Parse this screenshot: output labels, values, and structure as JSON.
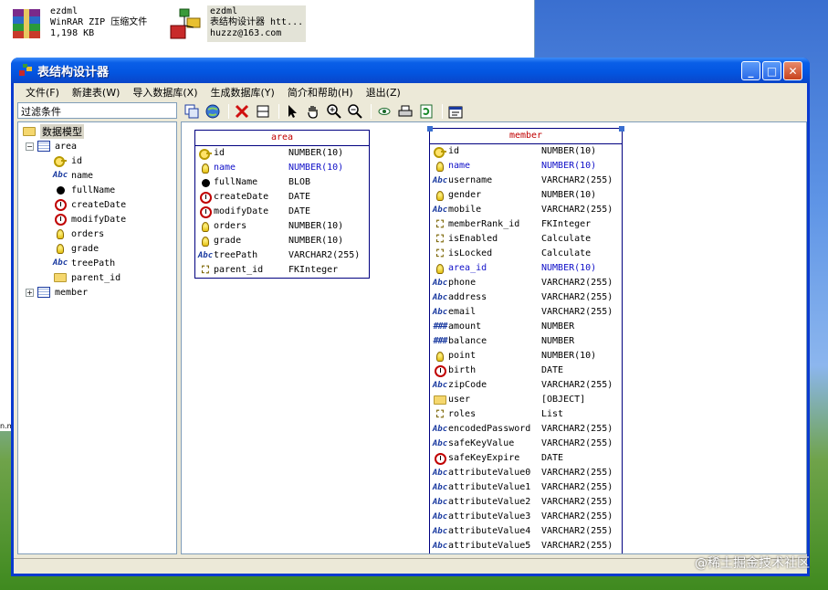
{
  "explorer": {
    "files": [
      {
        "name": "ezdml",
        "desc": "WinRAR ZIP 压缩文件",
        "size": "1,198 KB"
      },
      {
        "name": "ezdml",
        "desc": "表结构设计器 htt...",
        "size": "huzzz@163.com"
      }
    ],
    "strip_text": "n.m"
  },
  "window": {
    "title": "表结构设计器",
    "controls": {
      "minimize": "_",
      "maximize": "□",
      "close": "✕"
    }
  },
  "menu": [
    "文件(F)",
    "新建表(W)",
    "导入数据库(X)",
    "生成数据库(Y)",
    "简介和帮助(H)",
    "退出(Z)"
  ],
  "filter": {
    "label": "过滤条件"
  },
  "tree": {
    "root": "数据模型",
    "tables": [
      {
        "name": "area",
        "expanded": true,
        "fields": [
          {
            "name": "id",
            "icon": "key"
          },
          {
            "name": "name",
            "icon": "abc"
          },
          {
            "name": "fullName",
            "icon": "dot"
          },
          {
            "name": "createDate",
            "icon": "clock"
          },
          {
            "name": "modifyDate",
            "icon": "clock"
          },
          {
            "name": "orders",
            "icon": "bulb"
          },
          {
            "name": "grade",
            "icon": "bulb"
          },
          {
            "name": "treePath",
            "icon": "abc"
          },
          {
            "name": "parent_id",
            "icon": "folder"
          }
        ]
      },
      {
        "name": "member",
        "expanded": false,
        "fields": []
      }
    ]
  },
  "entities": {
    "area": {
      "title": "area",
      "fields": [
        {
          "name": "id",
          "type": "NUMBER(10)",
          "icon": "key",
          "blue": false
        },
        {
          "name": "name",
          "type": "NUMBER(10)",
          "icon": "bulb",
          "blue": true
        },
        {
          "name": "fullName",
          "type": "BLOB",
          "icon": "dot",
          "blue": false
        },
        {
          "name": "createDate",
          "type": "DATE",
          "icon": "clock",
          "blue": false
        },
        {
          "name": "modifyDate",
          "type": "DATE",
          "icon": "clock",
          "blue": false
        },
        {
          "name": "orders",
          "type": "NUMBER(10)",
          "icon": "bulb",
          "blue": false
        },
        {
          "name": "grade",
          "type": "NUMBER(10)",
          "icon": "bulb",
          "blue": false
        },
        {
          "name": "treePath",
          "type": "VARCHAR2(255)",
          "icon": "abc",
          "blue": false
        },
        {
          "name": "parent_id",
          "type": "FKInteger",
          "icon": "fk",
          "blue": false
        }
      ]
    },
    "member": {
      "title": "member",
      "fields": [
        {
          "name": "id",
          "type": "NUMBER(10)",
          "icon": "key",
          "blue": false
        },
        {
          "name": "name",
          "type": "NUMBER(10)",
          "icon": "bulb",
          "blue": true
        },
        {
          "name": "username",
          "type": "VARCHAR2(255)",
          "icon": "abc",
          "blue": false
        },
        {
          "name": "gender",
          "type": "NUMBER(10)",
          "icon": "bulb",
          "blue": false
        },
        {
          "name": "mobile",
          "type": "VARCHAR2(255)",
          "icon": "abc",
          "blue": false
        },
        {
          "name": "memberRank_id",
          "type": "FKInteger",
          "icon": "fk",
          "blue": false
        },
        {
          "name": "isEnabled",
          "type": "Calculate",
          "icon": "fk",
          "blue": false
        },
        {
          "name": "isLocked",
          "type": "Calculate",
          "icon": "fk",
          "blue": false
        },
        {
          "name": "area_id",
          "type": "NUMBER(10)",
          "icon": "bulb",
          "blue": true
        },
        {
          "name": "phone",
          "type": "VARCHAR2(255)",
          "icon": "abc",
          "blue": false
        },
        {
          "name": "address",
          "type": "VARCHAR2(255)",
          "icon": "abc",
          "blue": false
        },
        {
          "name": "email",
          "type": "VARCHAR2(255)",
          "icon": "abc",
          "blue": false
        },
        {
          "name": "amount",
          "type": "NUMBER",
          "icon": "hash",
          "blue": false
        },
        {
          "name": "balance",
          "type": "NUMBER",
          "icon": "hash",
          "blue": false
        },
        {
          "name": "point",
          "type": "NUMBER(10)",
          "icon": "bulb",
          "blue": false
        },
        {
          "name": "birth",
          "type": "DATE",
          "icon": "clock",
          "blue": false
        },
        {
          "name": "zipCode",
          "type": "VARCHAR2(255)",
          "icon": "abc",
          "blue": false
        },
        {
          "name": "user",
          "type": "[OBJECT]",
          "icon": "folder",
          "blue": false
        },
        {
          "name": "roles",
          "type": "List",
          "icon": "fk",
          "blue": false
        },
        {
          "name": "encodedPassword",
          "type": "VARCHAR2(255)",
          "icon": "abc",
          "blue": false
        },
        {
          "name": "safeKeyValue",
          "type": "VARCHAR2(255)",
          "icon": "abc",
          "blue": false
        },
        {
          "name": "safeKeyExpire",
          "type": "DATE",
          "icon": "clock",
          "blue": false
        },
        {
          "name": "attributeValue0",
          "type": "VARCHAR2(255)",
          "icon": "abc",
          "blue": false
        },
        {
          "name": "attributeValue1",
          "type": "VARCHAR2(255)",
          "icon": "abc",
          "blue": false
        },
        {
          "name": "attributeValue2",
          "type": "VARCHAR2(255)",
          "icon": "abc",
          "blue": false
        },
        {
          "name": "attributeValue3",
          "type": "VARCHAR2(255)",
          "icon": "abc",
          "blue": false
        },
        {
          "name": "attributeValue4",
          "type": "VARCHAR2(255)",
          "icon": "abc",
          "blue": false
        },
        {
          "name": "attributeValue5",
          "type": "VARCHAR2(255)",
          "icon": "abc",
          "blue": false
        }
      ]
    }
  },
  "watermark": "@稀土掘金技术社区"
}
